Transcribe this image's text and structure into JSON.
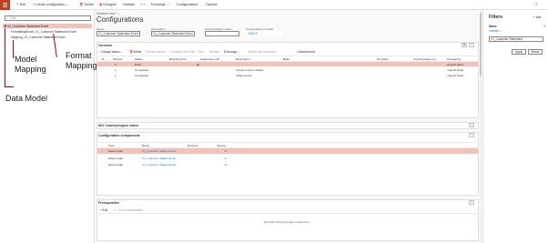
{
  "topbar": {
    "edit": "Edit",
    "create_configuration": "+ Create configuration",
    "delete": "Delete",
    "designer": "Designer",
    "validate": "Validate",
    "run": "Run",
    "exchange": "Exchange",
    "configurations": "Configurations",
    "options": "Options"
  },
  "tree": {
    "filter_placeholder": "Filter",
    "items": [
      {
        "label": "V1_Customer Statement Excel"
      },
      {
        "label": "FormatMapExcel_V1_Customer Statement Excel"
      },
      {
        "label": "Mapping_V1_Customer Statement Excel"
      }
    ]
  },
  "annotations": {
    "model_mapping": "Model\nMapping",
    "format_mapping": "Format\nMapping",
    "data_model": "Data Model"
  },
  "header": {
    "view_label": "Standard view *",
    "page_title": "Configurations",
    "fields": [
      {
        "label": "Name",
        "value": "V1_Customer Statement Excel"
      },
      {
        "label": "Description",
        "value": "V1_Customer Statement Excel"
      },
      {
        "label": "Country/region codes",
        "value": ""
      },
      {
        "label": "Configuration provider",
        "value": "LEDCS"
      }
    ]
  },
  "versions": {
    "title": "Versions",
    "actions": [
      "Change status",
      "Delete",
      "Get this version",
      "Compare with draft",
      "Run",
      "Rebase",
      "Exchange",
      "Upload into repository",
      "Attachments"
    ],
    "columns": [
      "R...",
      "Version",
      "Status",
      "Effective from",
      "Supported until",
      "Description",
      "Base",
      "Template",
      "Country/region co...",
      "Created by"
    ],
    "rows": [
      {
        "version": "3",
        "status": "Draft",
        "effective": "",
        "supported": "",
        "description": "",
        "created_by": "yugesh.patel"
      },
      {
        "version": "2",
        "status": "Completed",
        "effective": "",
        "supported": "",
        "description": "Invoice column added",
        "created_by": "Yogesh Patel"
      },
      {
        "version": "1",
        "status": "Completed",
        "effective": "",
        "supported": "",
        "description": "Initial version",
        "created_by": "Yogesh Patel"
      }
    ]
  },
  "iso": {
    "title": "ISO Country/region codes"
  },
  "components": {
    "title": "Configuration components",
    "columns": [
      "Type",
      "Name",
      "Derived",
      "Version"
    ],
    "rows": [
      {
        "type": "Data model",
        "name": "V1_Customer Statement E...",
        "version": "2"
      },
      {
        "type": "Data model",
        "name": "V1_Customer Statement E...",
        "version": "1"
      },
      {
        "type": "Data model",
        "name": "V1_Customer Statement E...",
        "version": "0"
      }
    ]
  },
  "prerequisites": {
    "title": "Prerequisites",
    "edit": "Edit",
    "check": "Check prerequisites",
    "empty": "We didn't find anything to show here."
  },
  "filters": {
    "title": "Filters",
    "add": "+ Add",
    "field_label": "Name",
    "operator": "contains",
    "value": "V1_Customer Statement",
    "apply": "Apply",
    "reset": "Reset"
  }
}
